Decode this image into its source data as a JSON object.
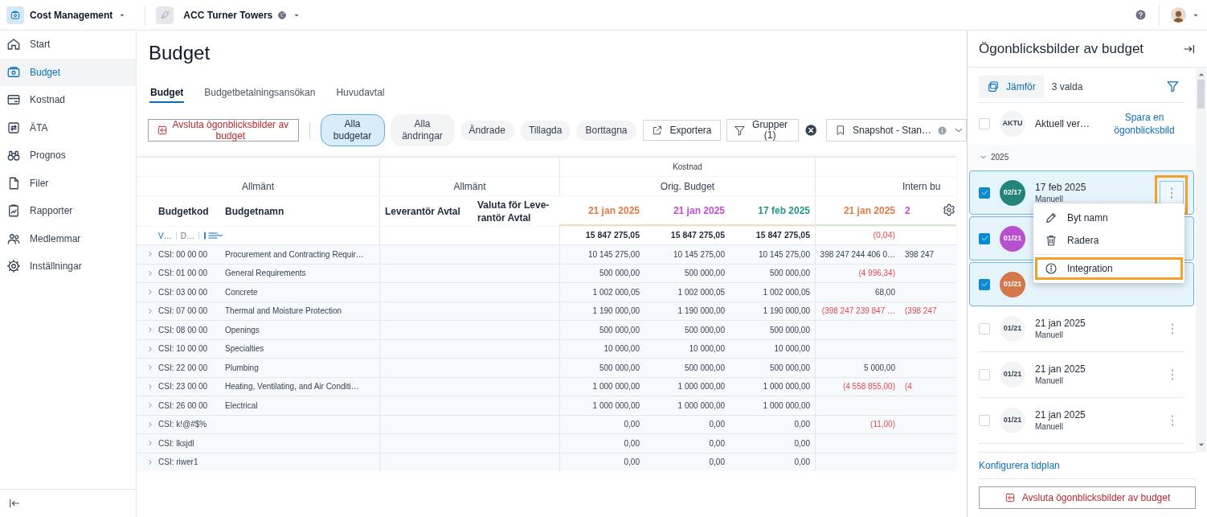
{
  "top_bar": {
    "app_name": "Cost Management",
    "project_name": "ACC Turner Towers"
  },
  "sidebar": {
    "items": [
      {
        "label": "Start",
        "selected": false
      },
      {
        "label": "Budget",
        "selected": true
      },
      {
        "label": "Kostnad",
        "selected": false
      },
      {
        "label": "ÄTA",
        "selected": false
      },
      {
        "label": "Prognos",
        "selected": false
      },
      {
        "label": "Filer",
        "selected": false
      },
      {
        "label": "Rapporter",
        "selected": false
      },
      {
        "label": "Medlemmar",
        "selected": false
      },
      {
        "label": "Inställningar",
        "selected": false
      }
    ]
  },
  "page": {
    "title": "Budget"
  },
  "tabs": [
    {
      "label": "Budget",
      "selected": true
    },
    {
      "label": "Budgetbetalningsansökan",
      "selected": false
    },
    {
      "label": "Huvudavtal",
      "selected": false
    }
  ],
  "toolbar": {
    "exit_button": "Avsluta ögonblicksbilder av budget",
    "filters": [
      {
        "label": "Alla budgetar",
        "selected": true
      },
      {
        "label": "Alla ändringar",
        "selected": false
      },
      {
        "label": "Ändrade",
        "selected": false
      },
      {
        "label": "Tillagda",
        "selected": false
      },
      {
        "label": "Borttagna",
        "selected": false
      }
    ],
    "export_button": "Exportera",
    "group_button": "Grupper (1)",
    "view_select": "Snapshot - Stan…"
  },
  "table": {
    "group_header": "Kostnad",
    "section_headers": [
      "Allmänt",
      "Allmänt",
      "Orig. Budget",
      "Intern bu"
    ],
    "columns": [
      {
        "label": "Budgetkod"
      },
      {
        "label": "Budgetnamn"
      },
      {
        "label": "Leverantör Avtal"
      },
      {
        "label": "Valuta för Leve-rantör Avtal"
      },
      {
        "label": "21 jan 2025",
        "color": "#e07b45"
      },
      {
        "label": "21 jan 2025",
        "color": "#c04fd0"
      },
      {
        "label": "17 feb 2025",
        "color": "#23968a"
      },
      {
        "label": "21 jan 2025",
        "color": "#e07b45"
      },
      {
        "label": "2",
        "color": "#c04fd0"
      }
    ],
    "filter_row": [
      "V…",
      "D…"
    ],
    "totals": {
      "orig": [
        "15 847 275,05",
        "15 847 275,05",
        "15 847 275,05"
      ],
      "intern": [
        {
          "text": "(0,04)",
          "negative": true
        }
      ]
    },
    "rows": [
      {
        "code": "CSI: 00 00 00",
        "name": "Procurement and Contracting Requir…",
        "expanded": false,
        "orig": [
          "10 145 275,00",
          "10 145 275,00",
          "10 145 275,00"
        ],
        "intern": [
          {
            "text": "398 247 244 406 0…",
            "negative": false
          },
          {
            "text": "398 247",
            "negative": false
          }
        ]
      },
      {
        "code": "CSI: 01 00 00",
        "name": "General Requirements",
        "expanded": false,
        "orig": [
          "500 000,00",
          "500 000,00",
          "500 000,00"
        ],
        "intern": [
          {
            "text": "(4 996,34)",
            "negative": true
          }
        ]
      },
      {
        "code": "CSI: 03 00 00",
        "name": "Concrete",
        "expanded": false,
        "orig": [
          "1 002 000,05",
          "1 002 000,05",
          "1 002 000,05"
        ],
        "intern": [
          {
            "text": "68,00",
            "negative": false
          }
        ]
      },
      {
        "code": "CSI: 07 00 00",
        "name": "Thermal and Moisture Protection",
        "expanded": false,
        "orig": [
          "1 190 000,00",
          "1 190 000,00",
          "1 190 000,00"
        ],
        "intern": [
          {
            "text": "(398 247 239 847 …",
            "negative": true
          },
          {
            "text": "(398 247",
            "negative": true
          }
        ]
      },
      {
        "code": "CSI: 08 00 00",
        "name": "Openings",
        "expanded": false,
        "orig": [
          "500 000,00",
          "500 000,00",
          "500 000,00"
        ],
        "intern": []
      },
      {
        "code": "CSI: 10 00 00",
        "name": "Specialties",
        "expanded": false,
        "orig": [
          "10 000,00",
          "10 000,00",
          "10 000,00"
        ],
        "intern": []
      },
      {
        "code": "CSI: 22 00 00",
        "name": "Plumbing",
        "expanded": false,
        "orig": [
          "500 000,00",
          "500 000,00",
          "500 000,00"
        ],
        "intern": [
          {
            "text": "5 000,00",
            "negative": false
          }
        ]
      },
      {
        "code": "CSI: 23 00 00",
        "name": "Heating, Ventilating, and Air Conditi…",
        "expanded": false,
        "orig": [
          "1 000 000,00",
          "1 000 000,00",
          "1 000 000,00"
        ],
        "intern": [
          {
            "text": "(4 558 855,00)",
            "negative": true
          },
          {
            "text": "(4",
            "negative": true
          }
        ]
      },
      {
        "code": "CSI: 26 00 00",
        "name": "Electrical",
        "expanded": false,
        "orig": [
          "1 000 000,00",
          "1 000 000,00",
          "1 000 000,00"
        ],
        "intern": []
      },
      {
        "code": "CSI: k!@#$%",
        "expanded": false,
        "orig": [
          "0,00",
          "0,00",
          "0,00"
        ],
        "intern": [
          {
            "text": "(11,00)",
            "negative": true
          }
        ]
      },
      {
        "code": "CSI: lksjdl",
        "expanded": false,
        "orig": [
          "0,00",
          "0,00",
          "0,00"
        ],
        "intern": []
      },
      {
        "code": "CSI: riwer1",
        "expanded": false,
        "orig": [
          "0,00",
          "0,00",
          "0,00"
        ],
        "intern": []
      }
    ]
  },
  "snapshot_panel": {
    "title": "Ögonblicksbilder av budget",
    "compare_button": "Jämför",
    "selected_count": "3 valda",
    "current": {
      "checked": false,
      "badge": "AKTU",
      "label": "Aktuell ver…",
      "save_link": "Spara en ögonblicksbild"
    },
    "group": {
      "label": "2025",
      "expanded": true
    },
    "snapshots": [
      {
        "badge": "02/17",
        "color": "#23857a",
        "title": "17 feb 2025",
        "subtitle": "Manuell",
        "checked": true,
        "menu_open": true,
        "annotated": true
      },
      {
        "badge": "01/21",
        "color": "#b84fcf",
        "checked": true,
        "menu_open": false,
        "annotated": false
      },
      {
        "badge": "01/21",
        "color": "#d4784c",
        "checked": true,
        "menu_open": false,
        "annotated": false
      },
      {
        "badge": "01/21",
        "title": "21 jan 2025",
        "subtitle": "Manuell",
        "checked": false,
        "menu_open": false,
        "annotated": false
      },
      {
        "badge": "01/21",
        "title": "21 jan 2025",
        "subtitle": "Manuell",
        "checked": false,
        "menu_open": false,
        "annotated": false
      },
      {
        "badge": "01/21",
        "title": "21 jan 2025",
        "subtitle": "Manuell",
        "checked": false,
        "menu_open": false,
        "annotated": false
      }
    ],
    "menu": {
      "items": [
        {
          "label": "Byt namn",
          "kind": "rename",
          "annotated": false
        },
        {
          "label": "Radera",
          "kind": "delete",
          "annotated": false
        },
        {
          "label": "Integration",
          "kind": "info",
          "annotated": true
        }
      ]
    },
    "schedule_link": "Konfigurera tidplan",
    "exit_button": "Avsluta ögonblicksbilder av budget"
  }
}
